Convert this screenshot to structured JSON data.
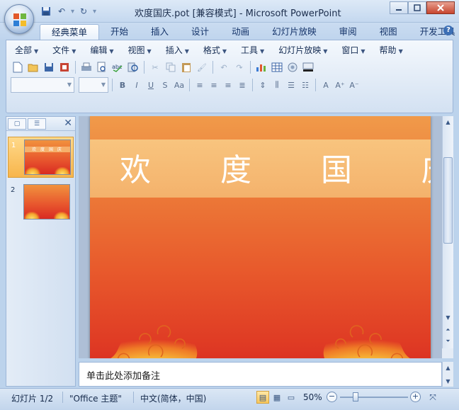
{
  "window": {
    "title": "欢度国庆.pot [兼容模式] - Microsoft PowerPoint"
  },
  "ribbon_tabs": [
    "经典菜单",
    "开始",
    "插入",
    "设计",
    "动画",
    "幻灯片放映",
    "审阅",
    "视图",
    "开发工具"
  ],
  "active_tab": 0,
  "classic_menu": [
    "全部",
    "文件",
    "编辑",
    "视图",
    "插入",
    "格式",
    "工具",
    "幻灯片放映",
    "窗口",
    "帮助"
  ],
  "slides_pane": {
    "slides": [
      {
        "number": "1",
        "title": "欢 度 国 庆",
        "selected": true
      },
      {
        "number": "2",
        "title": "",
        "selected": false
      }
    ]
  },
  "slide": {
    "title": "欢 度 国 庆"
  },
  "notes": {
    "placeholder": "单击此处添加备注"
  },
  "status": {
    "slide_info": "幻灯片 1/2",
    "theme": "\"Office 主题\"",
    "language": "中文(简体，中国)",
    "zoom": "50%"
  },
  "colors": {
    "slide_top": "#f09a4a",
    "slide_bottom": "#d92d22",
    "title_band": "#f6b56f",
    "selected_thumb": "#f7b54b"
  }
}
